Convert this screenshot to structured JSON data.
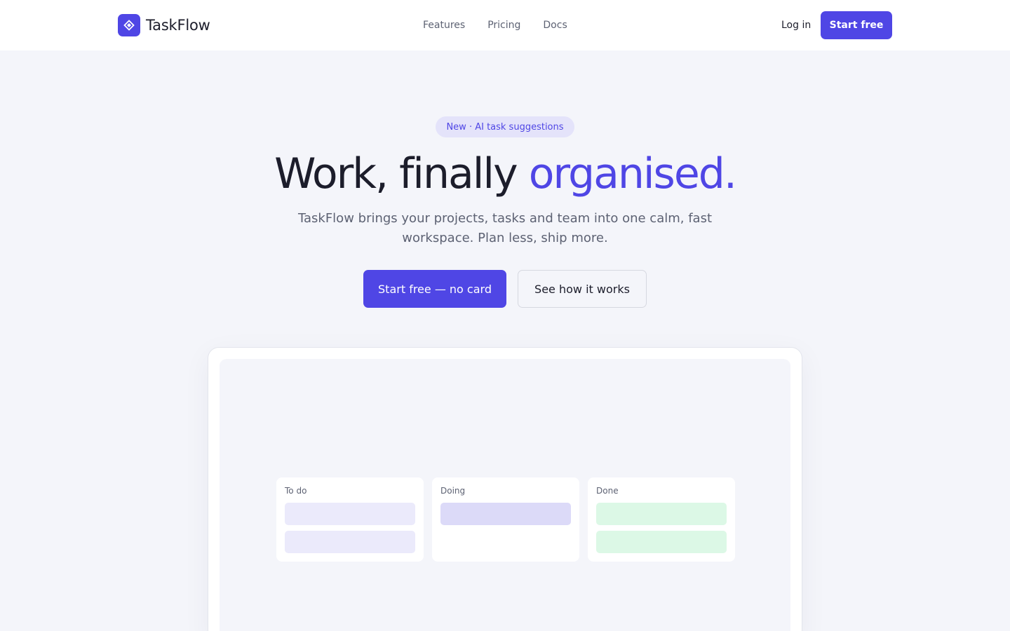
{
  "nav": {
    "brand": "TaskFlow",
    "links": [
      "Features",
      "Pricing",
      "Docs"
    ],
    "login": "Log in",
    "cta": "Start free"
  },
  "hero": {
    "badge": "New · AI task suggestions",
    "headline_main": "Work, finally",
    "headline_accent": "organised.",
    "subtitle": "TaskFlow brings your projects, tasks and team into one calm, fast workspace. Plan less, ship more.",
    "primary_cta": "Start free — no card",
    "secondary_cta": "See how it works"
  },
  "preview": {
    "columns": [
      {
        "title": "To do",
        "cards": 2
      },
      {
        "title": "Doing",
        "cards": 1
      },
      {
        "title": "Done",
        "cards": 2
      }
    ]
  },
  "colors": {
    "accent": "#4f46e5",
    "background": "#f4f5fa",
    "todo_card": "#ebeafb",
    "doing_card": "#dcdaf8",
    "done_card": "#dcf8e6"
  },
  "icons": {
    "logo": "diamond-logo-icon"
  }
}
